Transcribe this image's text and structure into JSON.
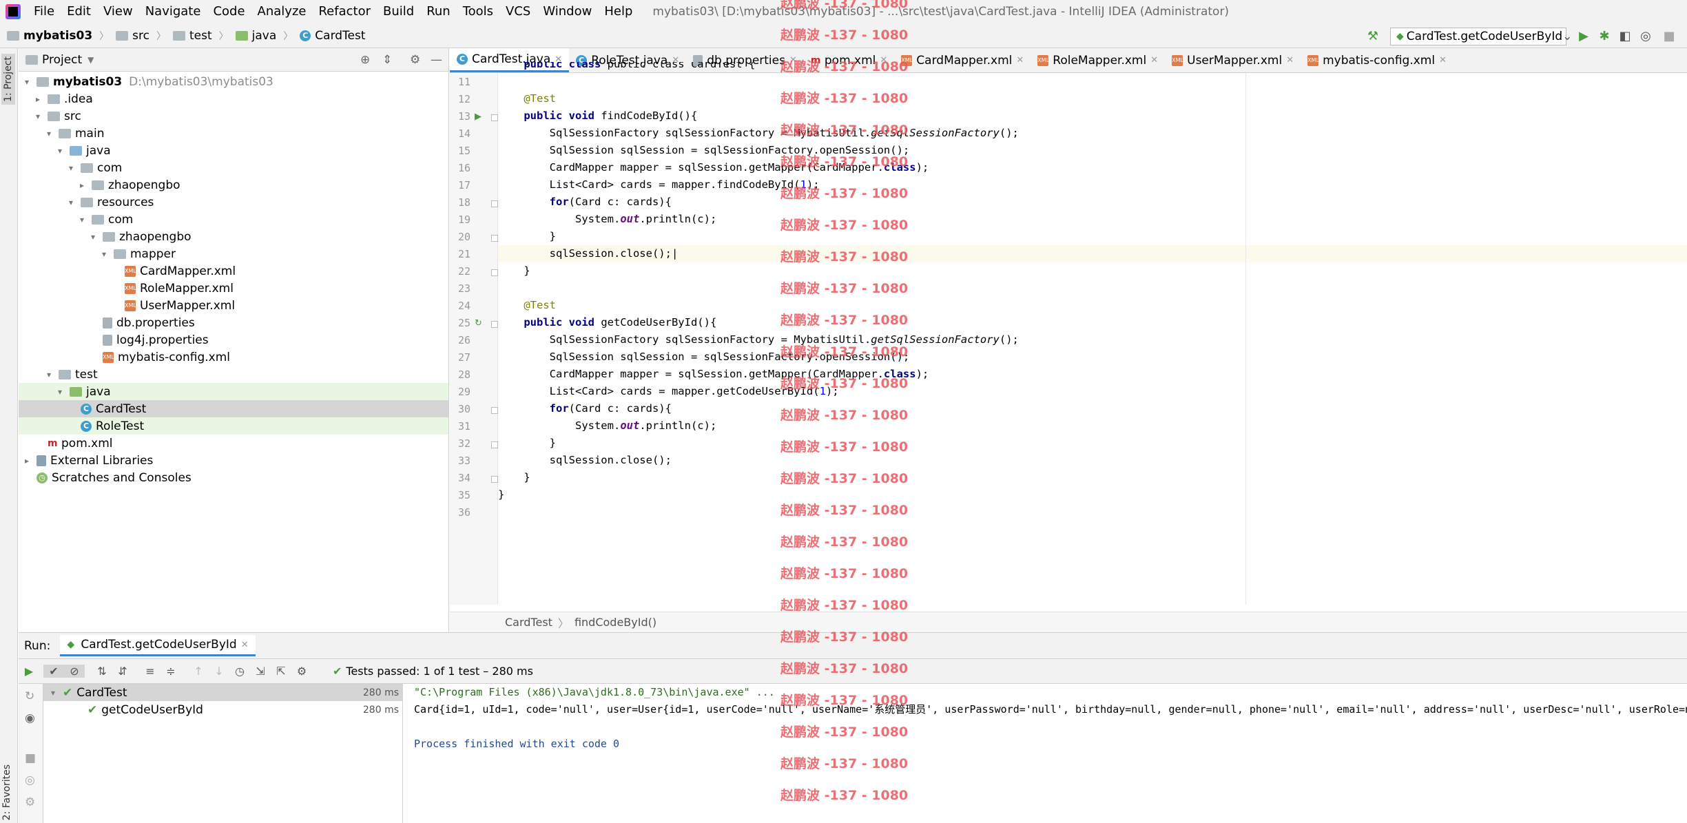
{
  "menubar": {
    "items": [
      {
        "label": "File"
      },
      {
        "label": "Edit"
      },
      {
        "label": "View"
      },
      {
        "label": "Navigate"
      },
      {
        "label": "Code"
      },
      {
        "label": "Analyze"
      },
      {
        "label": "Refactor"
      },
      {
        "label": "Build"
      },
      {
        "label": "Run"
      },
      {
        "label": "Tools"
      },
      {
        "label": "VCS"
      },
      {
        "label": "Window"
      },
      {
        "label": "Help"
      }
    ],
    "window_title": "mybatis03\\ [D:\\mybatis03\\mybatis03] - ...\\src\\test\\java\\CardTest.java - IntelliJ IDEA (Administrator)"
  },
  "navbar": {
    "crumbs": [
      "mybatis03",
      "src",
      "test",
      "java",
      "CardTest"
    ],
    "run_config": "CardTest.getCodeUserById"
  },
  "stripe": {
    "project": "1: Project",
    "favorites": "2: Favorites"
  },
  "project": {
    "title": "Project",
    "tree": [
      {
        "label": "mybatis03",
        "path": "D:\\mybatis03\\mybatis03",
        "arrow": "▾",
        "icon": "folder"
      },
      {
        "label": ".idea",
        "arrow": "▸",
        "icon": "folder"
      },
      {
        "label": "src",
        "arrow": "▾",
        "icon": "folder"
      },
      {
        "label": "main",
        "arrow": "▾",
        "icon": "folder"
      },
      {
        "label": "java",
        "arrow": "▾",
        "icon": "folder-blue"
      },
      {
        "label": "com",
        "arrow": "▾",
        "icon": "folder"
      },
      {
        "label": "zhaopengbo",
        "arrow": "▸",
        "icon": "folder"
      },
      {
        "label": "resources",
        "arrow": "▾",
        "icon": "folder"
      },
      {
        "label": "com",
        "arrow": "▾",
        "icon": "folder"
      },
      {
        "label": "zhaopengbo",
        "arrow": "▾",
        "icon": "folder"
      },
      {
        "label": "mapper",
        "arrow": "▾",
        "icon": "folder"
      },
      {
        "label": "CardMapper.xml",
        "arrow": "",
        "icon": "xml"
      },
      {
        "label": "RoleMapper.xml",
        "arrow": "",
        "icon": "xml"
      },
      {
        "label": "UserMapper.xml",
        "arrow": "",
        "icon": "xml"
      },
      {
        "label": "db.properties",
        "arrow": "",
        "icon": "prop"
      },
      {
        "label": "log4j.properties",
        "arrow": "",
        "icon": "prop"
      },
      {
        "label": "mybatis-config.xml",
        "arrow": "",
        "icon": "xml"
      },
      {
        "label": "test",
        "arrow": "▾",
        "icon": "folder"
      },
      {
        "label": "java",
        "arrow": "▾",
        "icon": "folder-green"
      },
      {
        "label": "CardTest",
        "arrow": "",
        "icon": "class"
      },
      {
        "label": "RoleTest",
        "arrow": "",
        "icon": "class"
      },
      {
        "label": "pom.xml",
        "arrow": "",
        "icon": "maven"
      },
      {
        "label": "External Libraries",
        "arrow": "▸",
        "icon": "lib"
      },
      {
        "label": "Scratches and Consoles",
        "arrow": "",
        "icon": "scratch"
      }
    ]
  },
  "editor": {
    "tabs": [
      {
        "label": "CardTest.java",
        "icon": "class"
      },
      {
        "label": "RoleTest.java",
        "icon": "class"
      },
      {
        "label": "db.properties",
        "icon": "prop"
      },
      {
        "label": "pom.xml",
        "icon": "maven"
      },
      {
        "label": "CardMapper.xml",
        "icon": "xml"
      },
      {
        "label": "RoleMapper.xml",
        "icon": "xml"
      },
      {
        "label": "UserMapper.xml",
        "icon": "xml"
      },
      {
        "label": "mybatis-config.xml",
        "icon": "xml"
      }
    ],
    "line_numbers": [
      "11",
      "12",
      "13",
      "14",
      "15",
      "16",
      "17",
      "18",
      "19",
      "20",
      "21",
      "22",
      "23",
      "24",
      "25",
      "26",
      "27",
      "28",
      "29",
      "30",
      "31",
      "32",
      "33",
      "34",
      "35",
      "36"
    ],
    "top_partial": "public class CardTest {",
    "breadcrumb": [
      "CardTest",
      "findCodeById()"
    ]
  },
  "run": {
    "title": "Run:",
    "config": "CardTest.getCodeUserById",
    "status": "Tests passed: 1 of 1 test – 280 ms",
    "tests": [
      {
        "label": "CardTest",
        "time": "280 ms"
      },
      {
        "label": "getCodeUserById",
        "time": "280 ms"
      }
    ],
    "console": [
      "\"C:\\Program Files (x86)\\Java\\jdk1.8.0_73\\bin\\java.exe\" ...",
      "Card{id=1, uId=1, code='null', user=User{id=1, userCode='null', userName='系统管理员', userPassword='null', birthday=null, gender=null, phone='null', email='null', address='null', userDesc='null', userRole=null",
      "",
      "Process finished with exit code 0"
    ]
  },
  "watermark": "赵鹏波 -137 - 1080",
  "colors": {
    "accent": "#4083c9",
    "pass": "#4a9d3e",
    "watermark": "#e8585e"
  }
}
